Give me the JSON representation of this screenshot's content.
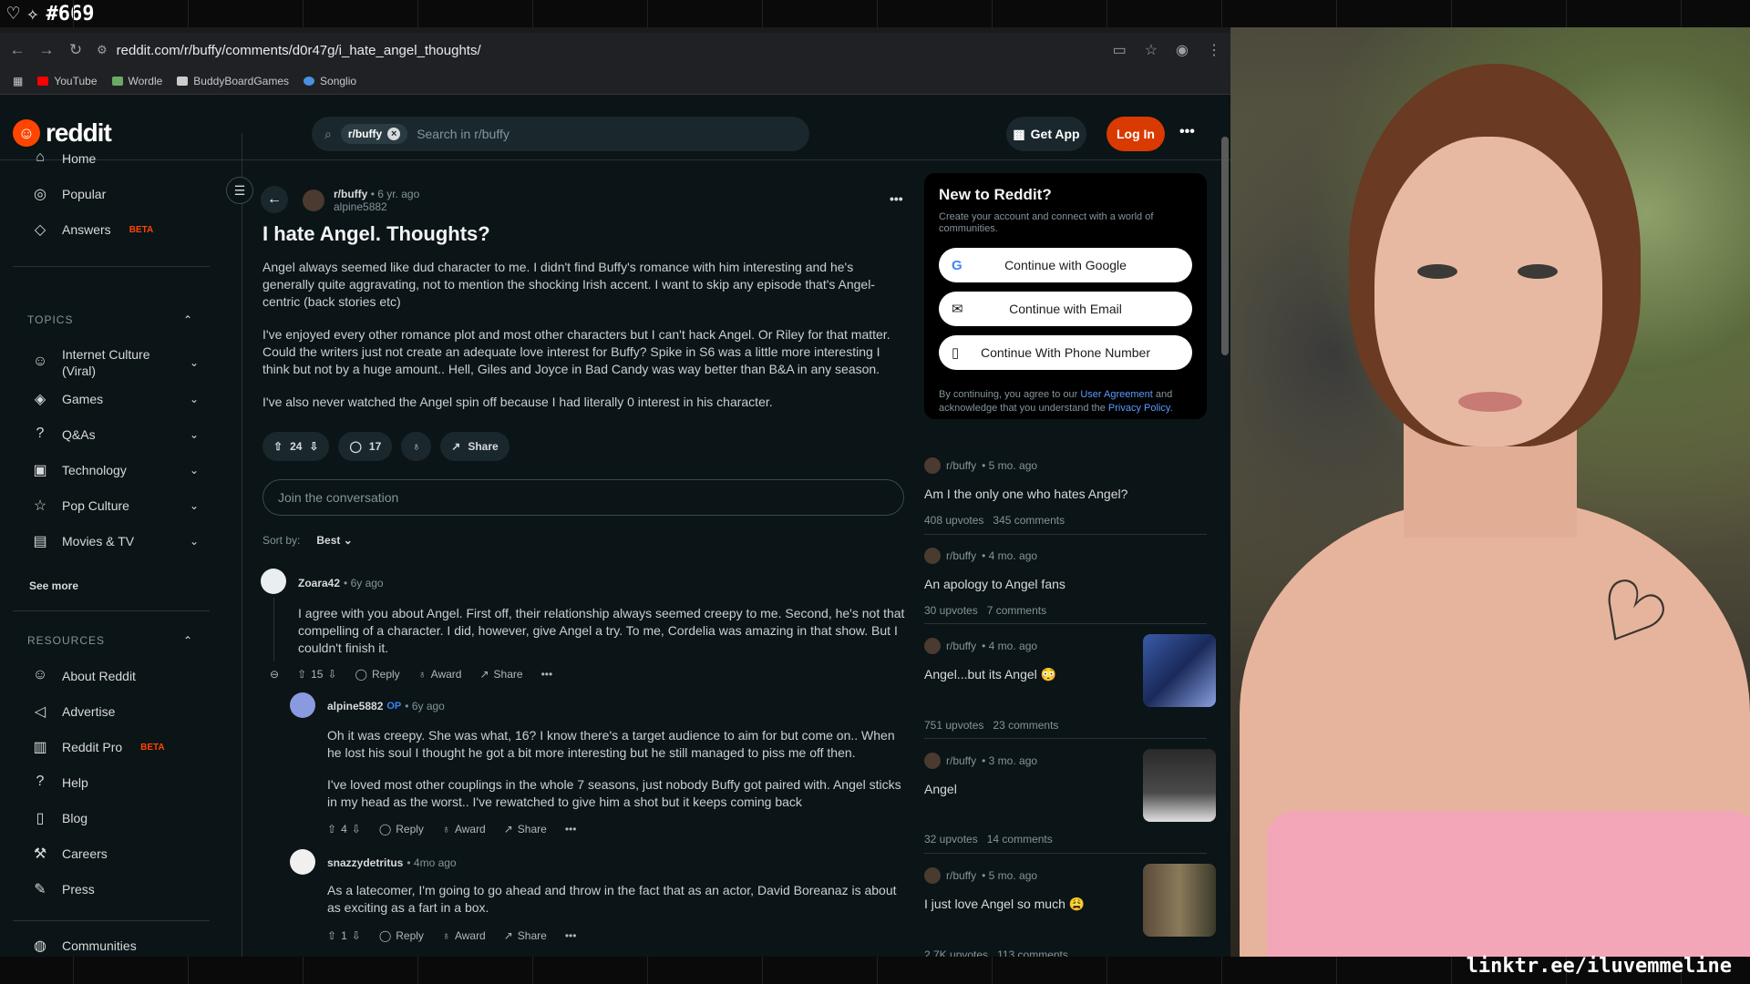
{
  "stream": {
    "counter": "#669",
    "handle": "linktr.ee/iluvemmeline"
  },
  "browser": {
    "url": "reddit.com/r/buffy/comments/d0r47g/i_hate_angel_thoughts/",
    "bookmarks": [
      {
        "label": "YouTube",
        "color": "#ff0000"
      },
      {
        "label": "Wordle",
        "color": "#6aaa64"
      },
      {
        "label": "BuddyBoardGames",
        "color": "#cccccc"
      },
      {
        "label": "Songlio",
        "color": "#4a90e2"
      }
    ]
  },
  "header": {
    "logo": "reddit",
    "search_chip": "r/buffy",
    "search_placeholder": "Search in r/buffy",
    "get_app": "Get App",
    "login": "Log In"
  },
  "leftnav": {
    "items": [
      {
        "label": "Home",
        "icon": "home-icon"
      },
      {
        "label": "Popular",
        "icon": "popular-icon"
      },
      {
        "label": "Answers",
        "badge": "BETA",
        "icon": "answers-icon"
      }
    ],
    "topics_title": "TOPICS",
    "topics": [
      {
        "label": "Internet Culture (Viral)"
      },
      {
        "label": "Games"
      },
      {
        "label": "Q&As"
      },
      {
        "label": "Technology"
      },
      {
        "label": "Pop Culture"
      },
      {
        "label": "Movies & TV"
      }
    ],
    "see_more": "See more",
    "resources_title": "RESOURCES",
    "resources": [
      {
        "label": "About Reddit"
      },
      {
        "label": "Advertise"
      },
      {
        "label": "Reddit Pro",
        "badge": "BETA"
      },
      {
        "label": "Help"
      },
      {
        "label": "Blog"
      },
      {
        "label": "Careers"
      },
      {
        "label": "Press"
      },
      {
        "label": "Communities"
      }
    ]
  },
  "post": {
    "subreddit": "r/buffy",
    "age": "• 6 yr. ago",
    "author": "alpine5882",
    "title": "I hate Angel. Thoughts?",
    "paragraphs": [
      "Angel always seemed like dud character to me. I didn't find Buffy's romance with him interesting and he's generally quite aggravating, not to mention the shocking Irish accent. I want to skip any episode that's Angel-centric (back stories etc)",
      "I've enjoyed every other romance plot and most other characters but I can't hack Angel. Or Riley for that matter. Could the writers just not create an adequate love interest for Buffy? Spike in S6 was a little more interesting I think but not by a huge amount.. Hell, Giles and Joyce in Bad Candy was way better than B&A in any season.",
      "I've also never watched the Angel spin off because I had literally 0 interest in his character."
    ],
    "votes": "24",
    "comments": "17",
    "share": "Share",
    "join_placeholder": "Join the conversation",
    "sort_label": "Sort by:",
    "sort_value": "Best"
  },
  "comments": [
    {
      "author": "Zoara42",
      "age": "• 6y ago",
      "text": "I agree with you about Angel. First off, their relationship always seemed creepy to me. Second, he's not that compelling of a character. I did, however, give Angel a try. To me, Cordelia was amazing in that show. But I couldn't finish it.",
      "votes": "15"
    },
    {
      "author": "alpine5882",
      "op": "OP",
      "age": "• 6y ago",
      "text1": "Oh it was creepy. She was what, 16? I know there's a target audience to aim for but come on.. When he lost his soul I thought he got a bit more interesting but he still managed to piss me off then.",
      "text2": "I've loved most other couplings in the whole 7 seasons, just nobody Buffy got paired with. Angel sticks in my head as the worst.. I've rewatched to give him a shot but it keeps coming back",
      "votes": "4"
    },
    {
      "author": "snazzydetritus",
      "age": "• 4mo ago",
      "text": "As a latecomer, I'm going to go ahead and throw in the fact that as an actor, David Boreanaz is about as exciting as a fart in a box.",
      "votes": "1"
    }
  ],
  "comment_actions": {
    "reply": "Reply",
    "award": "Award",
    "share": "Share"
  },
  "signup": {
    "title": "New to Reddit?",
    "subtitle": "Create your account and connect with a world of communities.",
    "google": "Continue with Google",
    "email": "Continue with Email",
    "phone": "Continue With Phone Number",
    "legal_pre": "By continuing, you agree to our ",
    "legal_link1": "User Agreement",
    "legal_mid": " and acknowledge that you understand the ",
    "legal_link2": "Privacy Policy."
  },
  "related": [
    {
      "sub": "r/buffy",
      "age": "• 5 mo. ago",
      "title": "Am I the only one who hates Angel?",
      "upvotes": "408 upvotes",
      "comments": "345 comments"
    },
    {
      "sub": "r/buffy",
      "age": "• 4 mo. ago",
      "title": "An apology to Angel fans",
      "upvotes": "30 upvotes",
      "comments": "7 comments"
    },
    {
      "sub": "r/buffy",
      "age": "• 4 mo. ago",
      "title": "Angel...but its Angel 😳",
      "upvotes": "751 upvotes",
      "comments": "23 comments"
    },
    {
      "sub": "r/buffy",
      "age": "• 3 mo. ago",
      "title": "Angel",
      "upvotes": "32 upvotes",
      "comments": "14 comments"
    },
    {
      "sub": "r/buffy",
      "age": "• 5 mo. ago",
      "title": "I just love Angel so much 😩",
      "upvotes": "2.7K upvotes",
      "comments": "113 comments"
    }
  ]
}
